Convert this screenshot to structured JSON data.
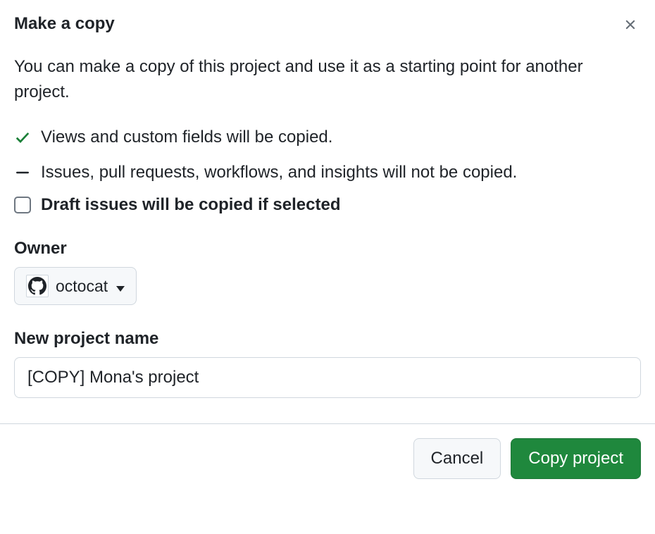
{
  "dialog": {
    "title": "Make a copy",
    "description": "You can make a copy of this project and use it as a starting point for another project.",
    "info_copied": "Views and custom fields will be copied.",
    "info_not_copied": "Issues, pull requests, workflows, and insights will not be copied.",
    "checkbox_label": "Draft issues will be copied if selected"
  },
  "owner": {
    "label": "Owner",
    "selected": "octocat"
  },
  "project_name": {
    "label": "New project name",
    "value": "[COPY] Mona's project"
  },
  "actions": {
    "cancel": "Cancel",
    "confirm": "Copy project"
  }
}
